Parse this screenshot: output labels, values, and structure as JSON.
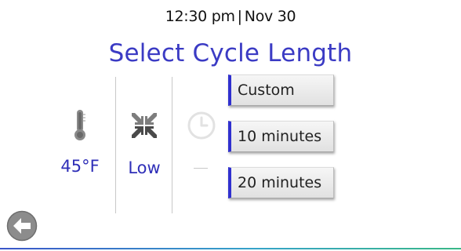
{
  "header": {
    "time": "12:30 pm",
    "separator": "|",
    "date": "Nov 30"
  },
  "title": "Select Cycle Length",
  "status": {
    "temperature": {
      "icon": "thermometer-icon",
      "value": "45°F"
    },
    "fan": {
      "icon": "compress-arrows-icon",
      "value": "Low"
    },
    "timer": {
      "icon": "clock-icon",
      "value": "—"
    }
  },
  "cycle_options": [
    {
      "label": "Custom"
    },
    {
      "label": "10 minutes"
    },
    {
      "label": "20 minutes"
    }
  ],
  "colors": {
    "title": "#3b3bc4",
    "accent": "#3030cf",
    "value_text": "#2f2fb8"
  },
  "nav": {
    "back_icon": "back-arrow-icon"
  }
}
